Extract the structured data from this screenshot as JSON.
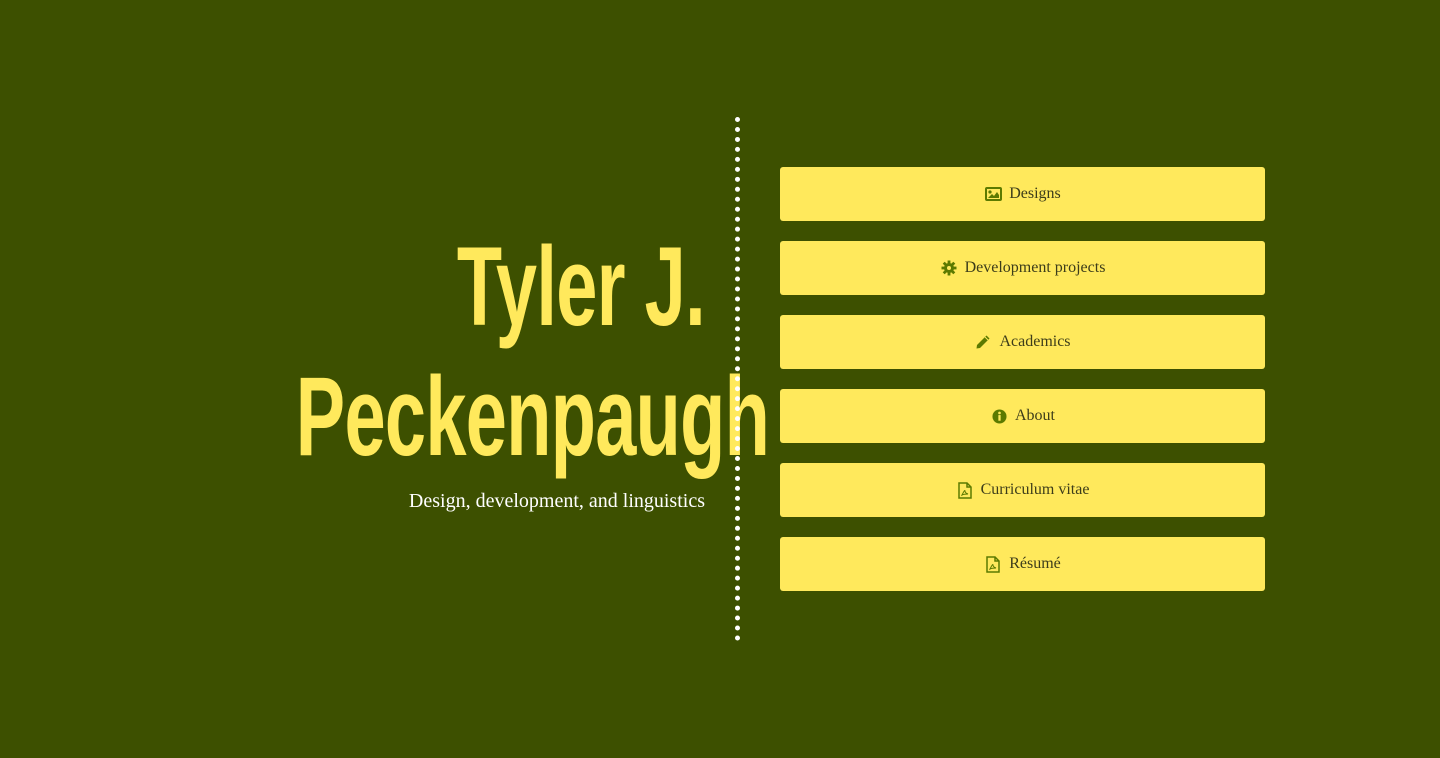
{
  "header": {
    "name_line_1": "Tyler J.",
    "name_line_2": "Peckenpaugh",
    "tagline": "Design, development, and linguistics"
  },
  "nav": {
    "items": [
      {
        "label": "Designs",
        "icon": "image-icon"
      },
      {
        "label": "Development projects",
        "icon": "gear-icon"
      },
      {
        "label": "Academics",
        "icon": "pencil-icon"
      },
      {
        "label": "About",
        "icon": "info-circle-icon"
      },
      {
        "label": "Curriculum vitae",
        "icon": "pdf-file-icon"
      },
      {
        "label": "Résumé",
        "icon": "pdf-file-icon"
      }
    ]
  },
  "colors": {
    "background": "#3d5000",
    "accent": "#ffe95c",
    "icon": "#5c7a00",
    "text_on_accent": "#3d3d1a",
    "tagline": "#ffffff"
  }
}
